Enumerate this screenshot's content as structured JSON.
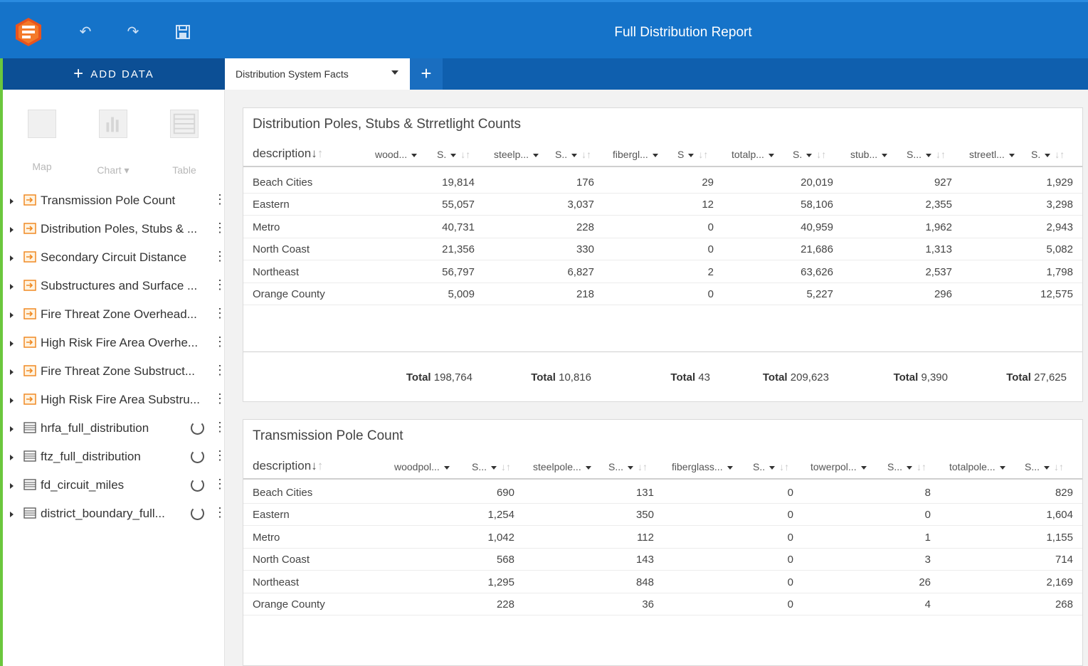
{
  "app": {
    "title": "Full Distribution Report"
  },
  "toolbar": {
    "undo_icon": "undo-icon",
    "redo_icon": "redo-icon",
    "save_icon": "save-icon"
  },
  "tabs": {
    "add_data_label": "ADD DATA",
    "active_tab_label": "Distribution System Facts",
    "add_tab_symbol": "+"
  },
  "viz_buttons": [
    {
      "label": "Map",
      "icon": "map-icon"
    },
    {
      "label": "Chart ▾",
      "icon": "chart-icon"
    },
    {
      "label": "Table",
      "icon": "table-icon"
    }
  ],
  "datasets": [
    {
      "label": "Transmission Pole Count",
      "type": "result"
    },
    {
      "label": "Distribution Poles, Stubs & ...",
      "type": "result"
    },
    {
      "label": "Secondary Circuit Distance",
      "type": "result"
    },
    {
      "label": "Substructures and Surface ...",
      "type": "result"
    },
    {
      "label": "Fire Threat Zone Overhead...",
      "type": "result"
    },
    {
      "label": "High Risk Fire Area Overhe...",
      "type": "result"
    },
    {
      "label": "Fire Threat Zone Substruct...",
      "type": "result"
    },
    {
      "label": "High Risk Fire Area Substru...",
      "type": "result"
    },
    {
      "label": "hrfa_full_distribution",
      "type": "table"
    },
    {
      "label": "ftz_full_distribution",
      "type": "table"
    },
    {
      "label": "fd_circuit_miles",
      "type": "table"
    },
    {
      "label": "district_boundary_full...",
      "type": "table"
    }
  ],
  "table1": {
    "title": "Distribution Poles, Stubs & Strretlight Counts",
    "desc_header": "description",
    "col_headers": [
      "wood...",
      "steelp...",
      "fibergl...",
      "totalp...",
      "stub...",
      "streetl..."
    ],
    "stat_headers": [
      "S.",
      "S..",
      "S",
      "S.",
      "S...",
      "S."
    ],
    "rows": [
      {
        "name": "Beach Cities",
        "values": [
          "19,814",
          "176",
          "29",
          "20,019",
          "927",
          "1,929"
        ]
      },
      {
        "name": "Eastern",
        "values": [
          "55,057",
          "3,037",
          "12",
          "58,106",
          "2,355",
          "3,298"
        ]
      },
      {
        "name": "Metro",
        "values": [
          "40,731",
          "228",
          "0",
          "40,959",
          "1,962",
          "2,943"
        ]
      },
      {
        "name": "North Coast",
        "values": [
          "21,356",
          "330",
          "0",
          "21,686",
          "1,313",
          "5,082"
        ]
      },
      {
        "name": "Northeast",
        "values": [
          "56,797",
          "6,827",
          "2",
          "63,626",
          "2,537",
          "1,798"
        ]
      },
      {
        "name": "Orange County",
        "values": [
          "5,009",
          "218",
          "0",
          "5,227",
          "296",
          "12,575"
        ]
      }
    ],
    "total_label": "Total",
    "totals": [
      "198,764",
      "10,816",
      "43",
      "209,623",
      "9,390",
      "27,625"
    ]
  },
  "table2": {
    "title": "Transmission Pole Count",
    "desc_header": "description",
    "col_headers": [
      "woodpol...",
      "steelpole...",
      "fiberglass...",
      "towerpol...",
      "totalpole..."
    ],
    "stat_headers": [
      "S...",
      "S...",
      "S..",
      "S...",
      "S..."
    ],
    "rows": [
      {
        "name": "Beach Cities",
        "values": [
          "690",
          "131",
          "0",
          "8",
          "829"
        ]
      },
      {
        "name": "Eastern",
        "values": [
          "1,254",
          "350",
          "0",
          "0",
          "1,604"
        ]
      },
      {
        "name": "Metro",
        "values": [
          "1,042",
          "112",
          "0",
          "1",
          "1,155"
        ]
      },
      {
        "name": "North Coast",
        "values": [
          "568",
          "143",
          "0",
          "3",
          "714"
        ]
      },
      {
        "name": "Northeast",
        "values": [
          "1,295",
          "848",
          "0",
          "26",
          "2,169"
        ]
      },
      {
        "name": "Orange County",
        "values": [
          "228",
          "36",
          "0",
          "4",
          "268"
        ]
      }
    ]
  }
}
